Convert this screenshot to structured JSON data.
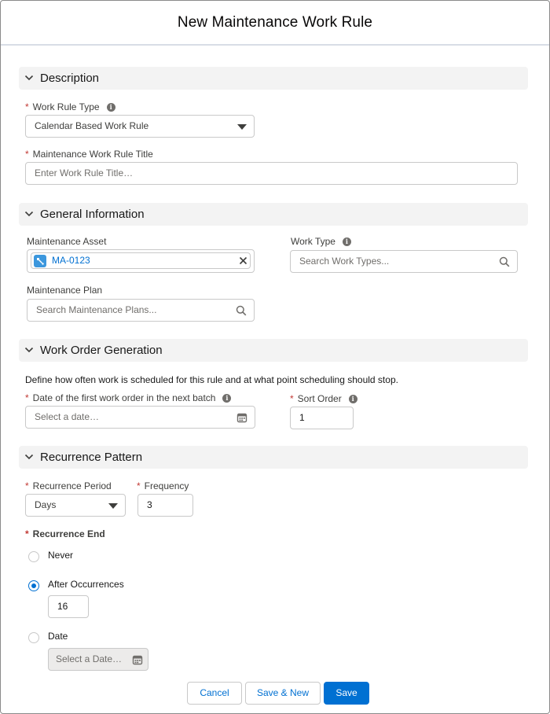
{
  "modal": {
    "title": "New Maintenance Work Rule"
  },
  "sections": {
    "description": "Description",
    "general": "General Information",
    "work_order": "Work Order Generation",
    "recurrence": "Recurrence Pattern"
  },
  "description": {
    "work_rule_type_label": "Work Rule Type",
    "work_rule_type_value": "Calendar Based Work Rule",
    "title_label": "Maintenance Work Rule Title",
    "title_placeholder": "Enter Work Rule Title…"
  },
  "general": {
    "asset_label": "Maintenance Asset",
    "asset_value": "MA-0123",
    "work_type_label": "Work Type",
    "work_type_placeholder": "Search Work Types...",
    "plan_label": "Maintenance Plan",
    "plan_placeholder": "Search Maintenance Plans..."
  },
  "work_order": {
    "description": "Define how often work is scheduled for this rule and at what point scheduling should stop.",
    "first_date_label": "Date of the first work order in the next batch",
    "first_date_placeholder": "Select a date…",
    "sort_order_label": "Sort Order",
    "sort_order_value": "1"
  },
  "recurrence": {
    "period_label": "Recurrence Period",
    "period_value": "Days",
    "frequency_label": "Frequency",
    "frequency_value": "3",
    "end_label": "Recurrence End",
    "options": [
      "Never",
      "After Occurrences",
      "Date"
    ],
    "selected": "After Occurrences",
    "occurrences_value": "16",
    "date_placeholder": "Select a Date…"
  },
  "footer": {
    "cancel": "Cancel",
    "save_new": "Save & New",
    "save": "Save"
  },
  "colors": {
    "brand": "#0070d2",
    "required": "#c23934",
    "section_bg": "#f3f3f3",
    "asset_icon": "#3c97dd"
  },
  "icons": {
    "section_toggle": "chevron-down-icon",
    "info": "info-icon",
    "dropdown": "caret-down-icon",
    "search": "search-icon",
    "calendar": "calendar-icon",
    "clear": "close-icon",
    "asset": "maintenance-asset-icon"
  }
}
